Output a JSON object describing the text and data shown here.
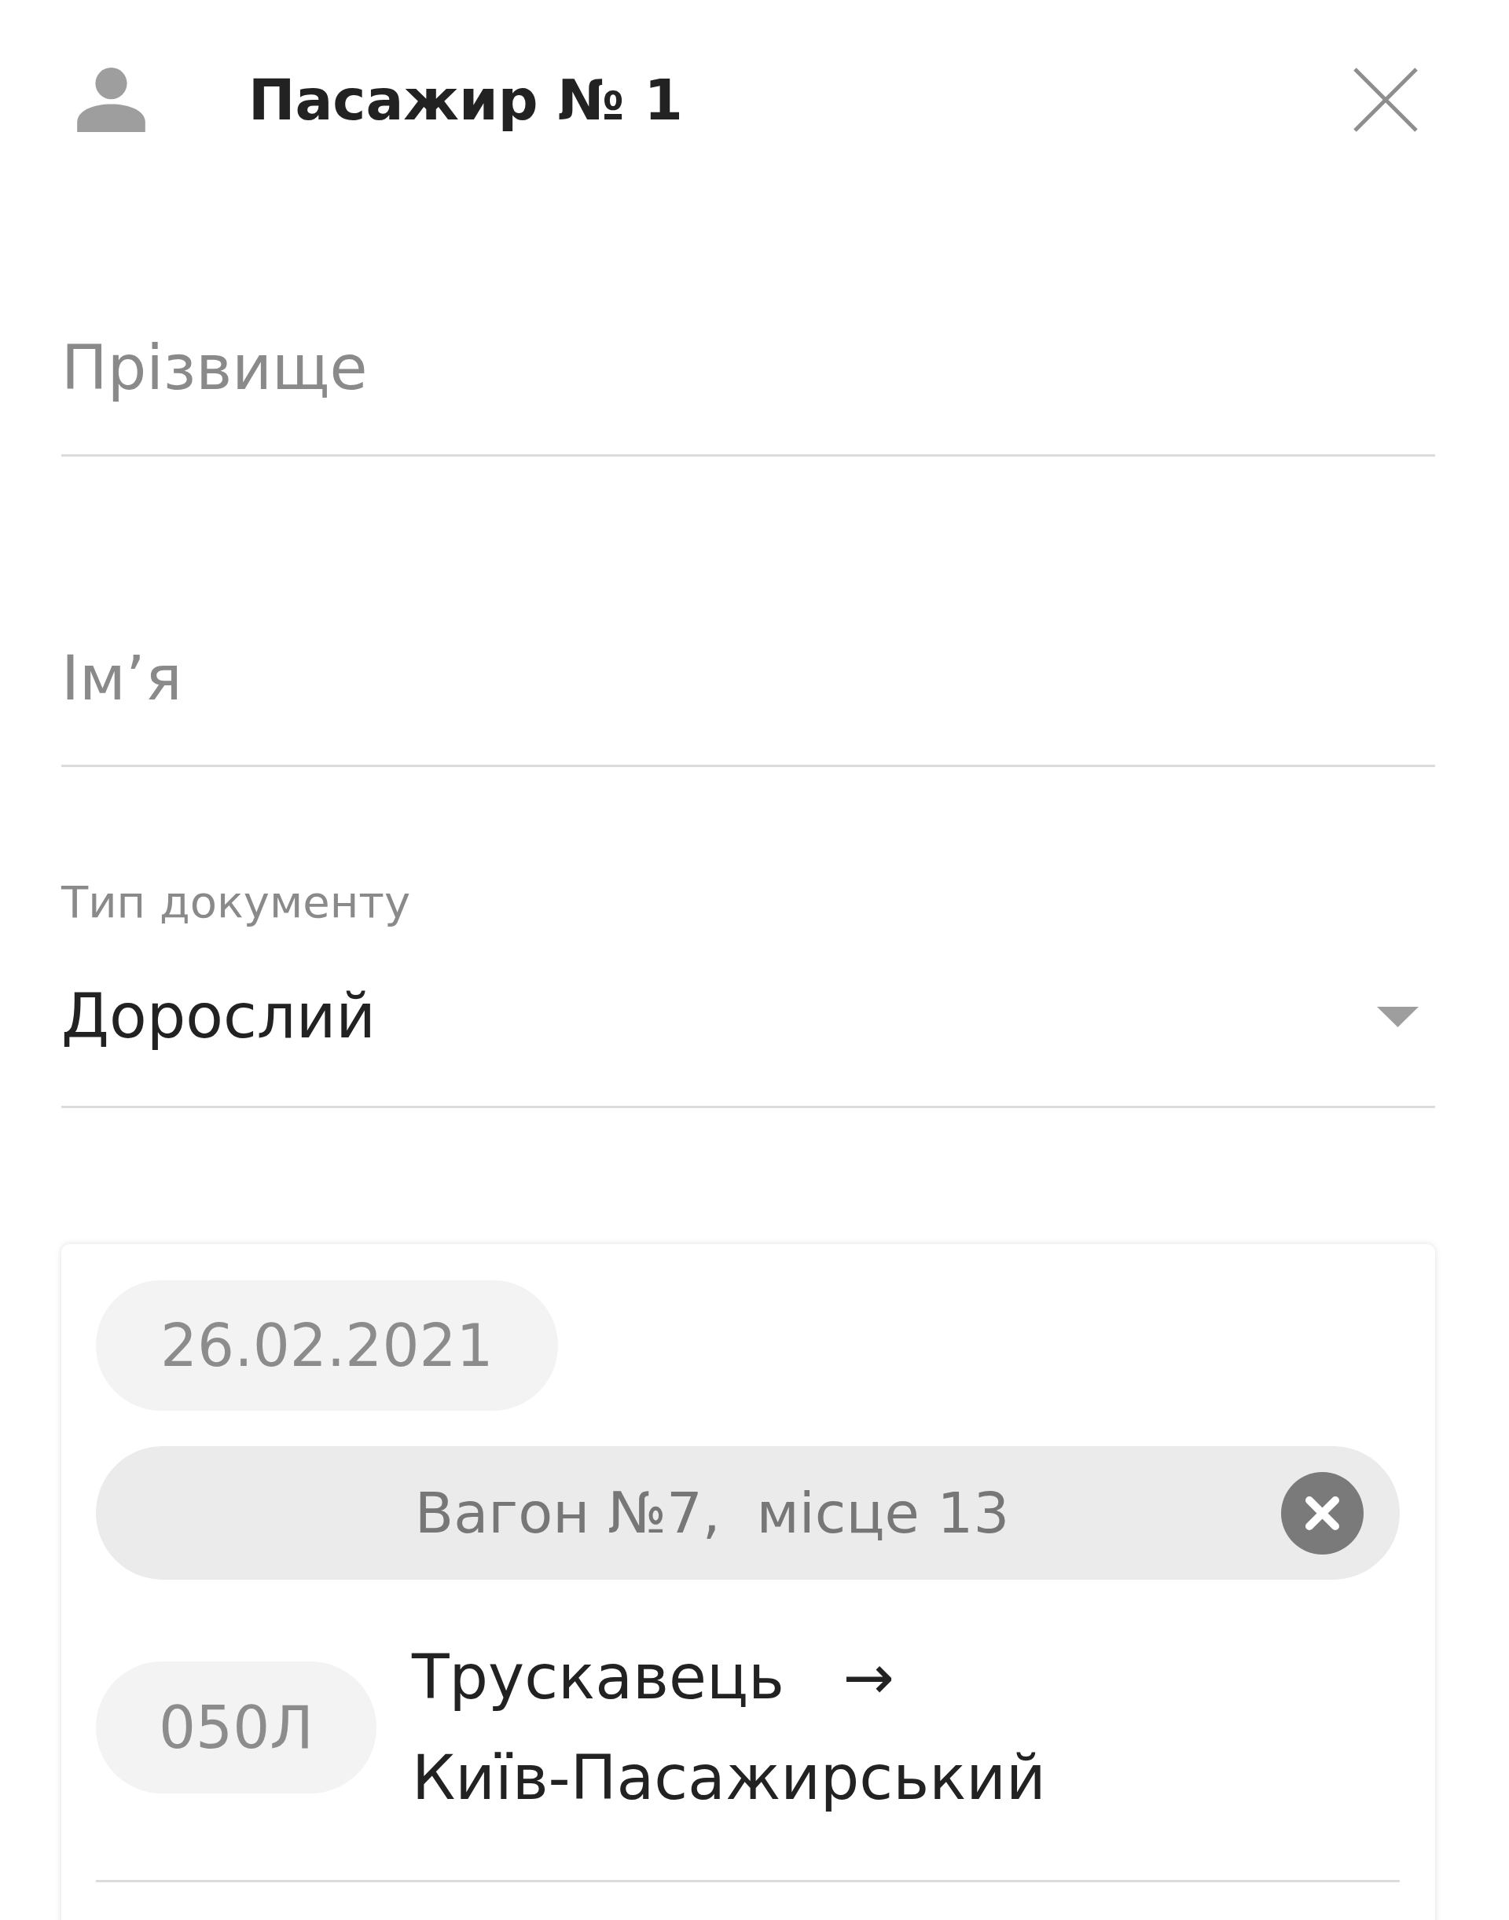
{
  "header": {
    "title": "Пасажир № 1"
  },
  "fields": [
    {
      "kind": "text",
      "placeholder": "Прізвище"
    },
    {
      "kind": "text",
      "placeholder": "Ім’я"
    },
    {
      "kind": "select",
      "label": "Тип документу",
      "value": "Дорослий"
    }
  ],
  "ticket": {
    "date": "26.02.2021",
    "seat": "Вагон №7,  місце 13",
    "train": "050Л",
    "route": {
      "from": "Трускавець",
      "arrow": "→",
      "to": "Київ-Пасажирський"
    }
  }
}
